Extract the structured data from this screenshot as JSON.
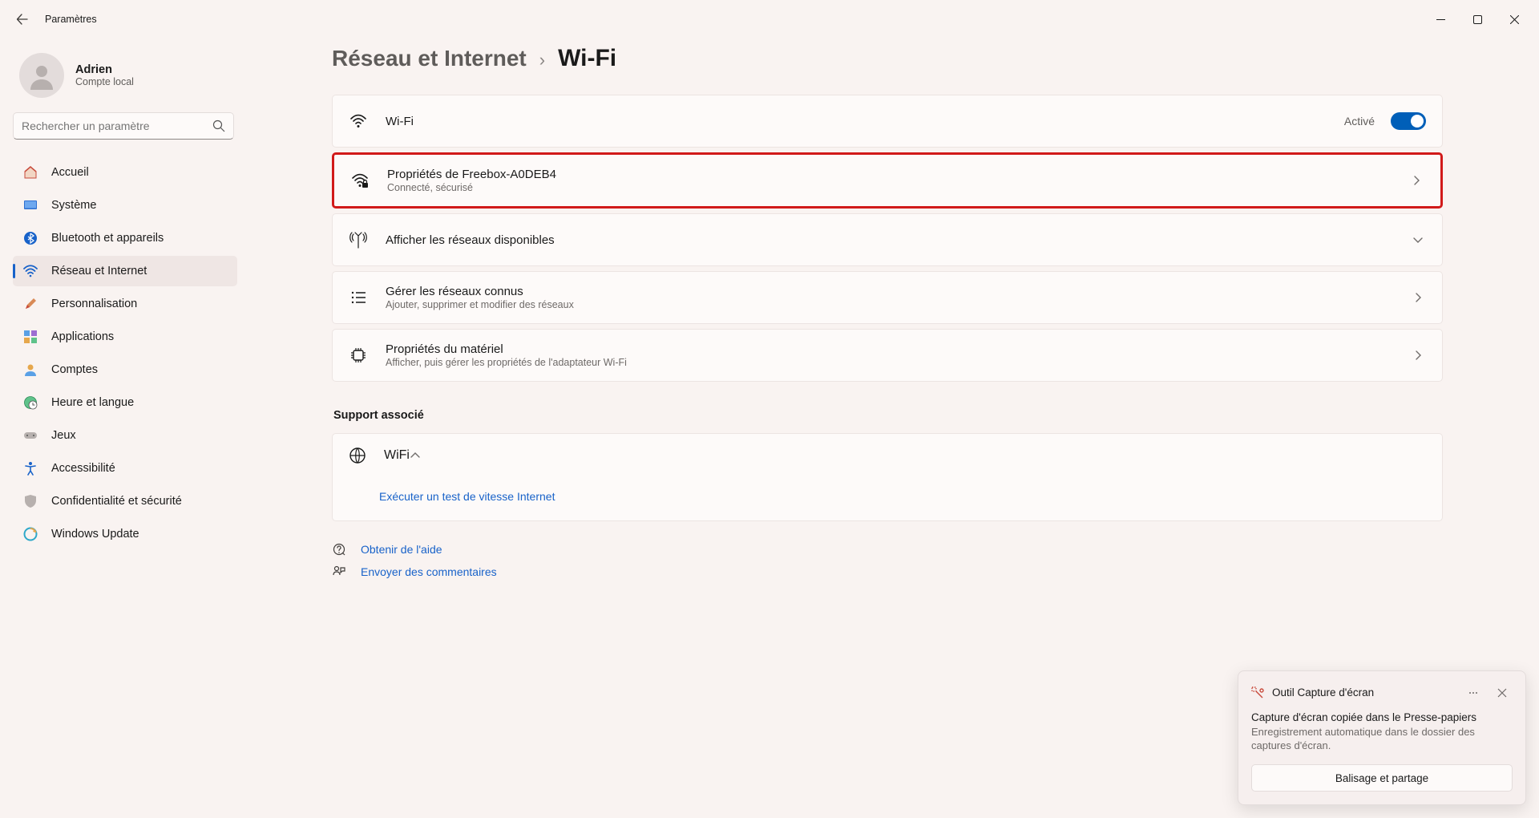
{
  "titlebar": {
    "title": "Paramètres"
  },
  "profile": {
    "name": "Adrien",
    "sub": "Compte local"
  },
  "search": {
    "placeholder": "Rechercher un paramètre"
  },
  "nav": {
    "items": [
      {
        "label": "Accueil"
      },
      {
        "label": "Système"
      },
      {
        "label": "Bluetooth et appareils"
      },
      {
        "label": "Réseau et Internet"
      },
      {
        "label": "Personnalisation"
      },
      {
        "label": "Applications"
      },
      {
        "label": "Comptes"
      },
      {
        "label": "Heure et langue"
      },
      {
        "label": "Jeux"
      },
      {
        "label": "Accessibilité"
      },
      {
        "label": "Confidentialité et sécurité"
      },
      {
        "label": "Windows Update"
      }
    ]
  },
  "breadcrumb": {
    "parent": "Réseau et Internet",
    "current": "Wi-Fi"
  },
  "cards": {
    "wifi": {
      "title": "Wi-Fi",
      "status": "Activé"
    },
    "props": {
      "title": "Propriétés de Freebox-A0DEB4",
      "sub": "Connecté, sécurisé"
    },
    "available": {
      "title": "Afficher les réseaux disponibles"
    },
    "known": {
      "title": "Gérer les réseaux connus",
      "sub": "Ajouter, supprimer et modifier des réseaux"
    },
    "hardware": {
      "title": "Propriétés du matériel",
      "sub": "Afficher, puis gérer les propriétés de l'adaptateur Wi-Fi"
    }
  },
  "support": {
    "section": "Support associé",
    "title": "WiFi",
    "link": "Exécuter un test de vitesse Internet"
  },
  "footer": {
    "help": "Obtenir de l'aide",
    "feedback": "Envoyer des commentaires"
  },
  "toast": {
    "app": "Outil Capture d'écran",
    "msg1": "Capture d'écran copiée dans le Presse-papiers",
    "msg2": "Enregistrement automatique dans le dossier des captures d'écran.",
    "action": "Balisage et partage"
  }
}
